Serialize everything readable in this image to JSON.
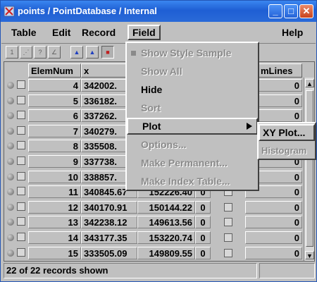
{
  "window": {
    "title": "points / PointDatabase / Internal",
    "controls": {
      "minimize": "_",
      "maximize": "□",
      "close": "✕"
    }
  },
  "menubar": {
    "items": [
      "Table",
      "Edit",
      "Record",
      "Field",
      "Help"
    ],
    "active": "Field"
  },
  "toolbar": {
    "icons": [
      "new-icon",
      "select-icon",
      "query-icon",
      "sort-icon",
      "stats-icon",
      "filter-icon",
      "chart-icon"
    ]
  },
  "table": {
    "headers": {
      "elemnum": "ElemNum",
      "x": "x",
      "numlines": "mLines"
    },
    "rows": [
      {
        "elemnum": "4",
        "x": "342002.",
        "y": "",
        "numlines": "0"
      },
      {
        "elemnum": "5",
        "x": "336182.",
        "y": "",
        "numlines": "0"
      },
      {
        "elemnum": "6",
        "x": "337262.",
        "y": "",
        "numlines": "0"
      },
      {
        "elemnum": "7",
        "x": "340279.",
        "y": "",
        "numlines": "0"
      },
      {
        "elemnum": "8",
        "x": "335508.",
        "y": "",
        "numlines": "0"
      },
      {
        "elemnum": "9",
        "x": "337738.",
        "y": "",
        "numlines": "0"
      },
      {
        "elemnum": "10",
        "x": "338857.",
        "y": "",
        "numlines": "0"
      },
      {
        "elemnum": "11",
        "x": "340845.67",
        "y": "152226.40",
        "flag": "0",
        "numlines": "0"
      },
      {
        "elemnum": "12",
        "x": "340170.91",
        "y": "150144.22",
        "flag": "0",
        "numlines": "0"
      },
      {
        "elemnum": "13",
        "x": "342238.12",
        "y": "149613.56",
        "flag": "0",
        "numlines": "0"
      },
      {
        "elemnum": "14",
        "x": "343177.35",
        "y": "153220.74",
        "flag": "0",
        "numlines": "0"
      },
      {
        "elemnum": "15",
        "x": "333505.09",
        "y": "149809.55",
        "flag": "0",
        "numlines": "0"
      }
    ]
  },
  "field_menu": {
    "items": [
      {
        "label": "Show Style Sample",
        "enabled": false,
        "checked": true
      },
      {
        "label": "Show All",
        "enabled": false
      },
      {
        "label": "Hide",
        "enabled": true
      },
      {
        "label": "Sort",
        "enabled": false
      },
      {
        "label": "Plot",
        "enabled": true,
        "submenu": true
      },
      {
        "label": "Options...",
        "enabled": false
      },
      {
        "label": "Make Permanent...",
        "enabled": false
      },
      {
        "label": "Make Index Table...",
        "enabled": false
      }
    ]
  },
  "plot_submenu": {
    "items": [
      {
        "label": "XY Plot...",
        "enabled": true
      },
      {
        "label": "Histogram",
        "enabled": false
      }
    ]
  },
  "status": {
    "text": "22 of 22 records shown"
  }
}
